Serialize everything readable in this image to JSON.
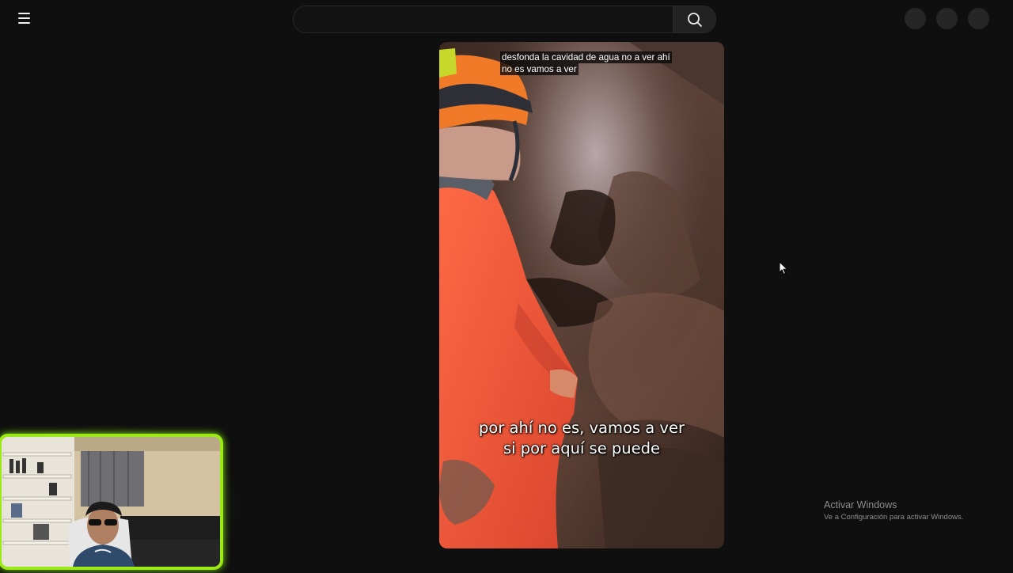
{
  "header": {
    "menu_icon": "hamburger-menu-icon",
    "search": {
      "value": "",
      "placeholder": "",
      "icon": "search-icon"
    },
    "right_icons": [
      "circle-icon",
      "circle-icon",
      "circle-icon"
    ]
  },
  "video": {
    "top_caption": "desfonda la cavidad de agua no a ver ahí no es vamos a ver",
    "subtitle_line1": "por ahí no es, vamos a ver",
    "subtitle_line2": "si por aquí se puede"
  },
  "webcam": {
    "border_color": "#9bea16"
  },
  "watermark": {
    "title": "Activar Windows",
    "subtitle": "Ve a Configuración para activar Windows."
  },
  "colors": {
    "background": "#0f0f0f",
    "accent_green": "#9bea16"
  }
}
